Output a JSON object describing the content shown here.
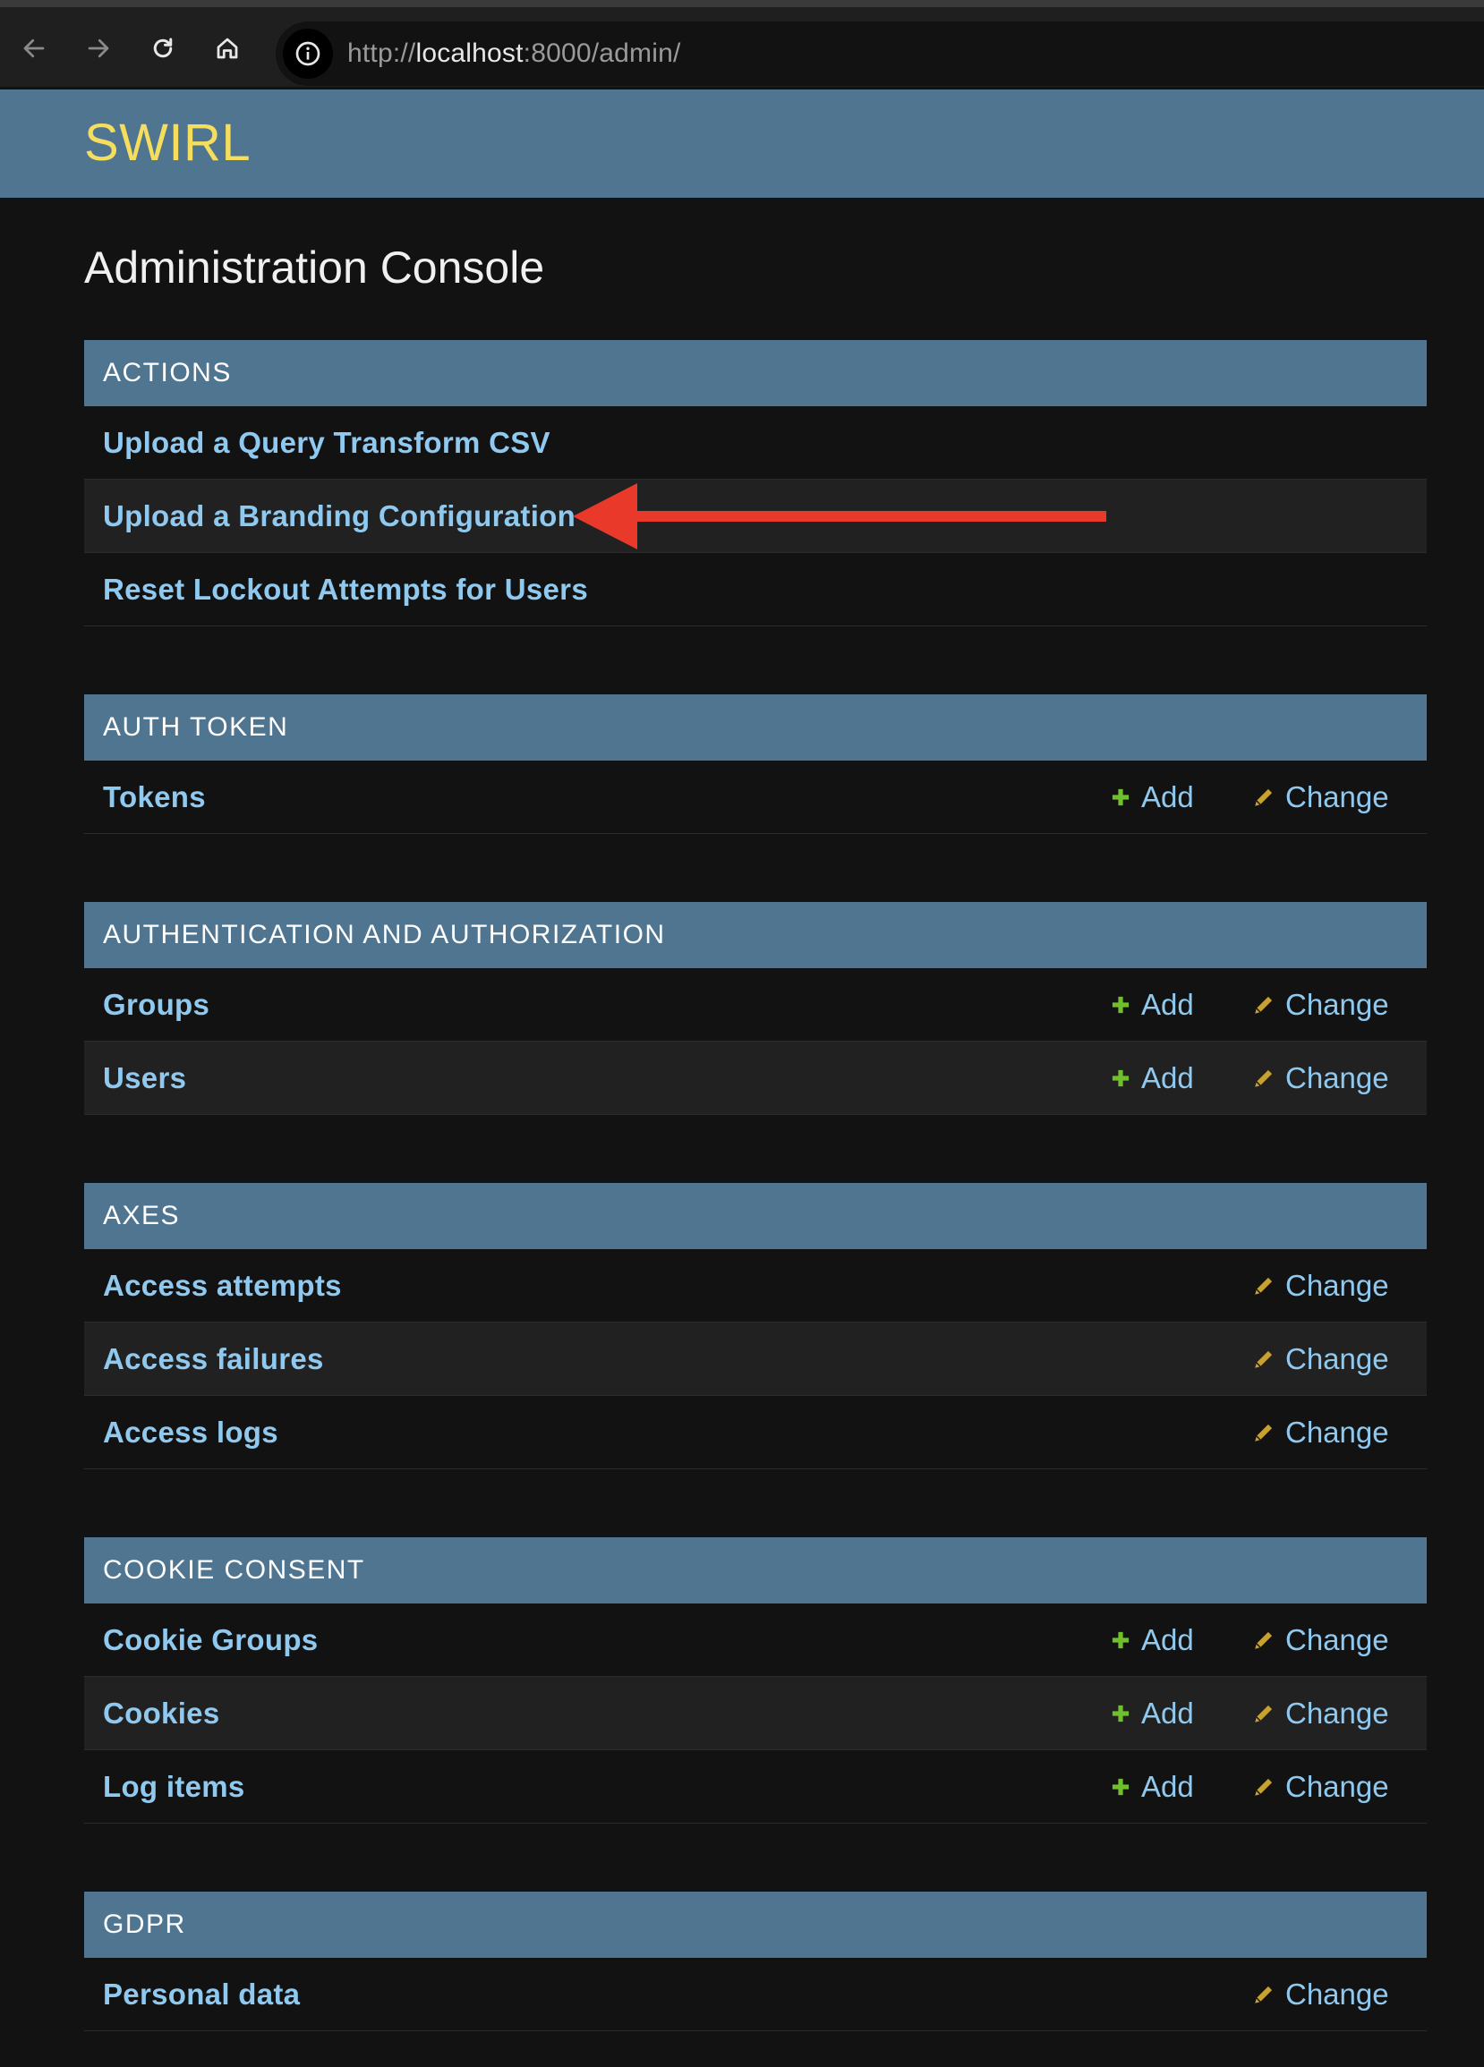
{
  "browser": {
    "url_scheme": "http://",
    "url_host": "localhost",
    "url_rest": ":8000/admin/"
  },
  "header": {
    "brand": "SWIRL"
  },
  "page": {
    "title": "Administration Console"
  },
  "actions": {
    "caption": "ACTIONS",
    "items": [
      {
        "label": "Upload a Query Transform CSV"
      },
      {
        "label": "Upload a Branding Configuration"
      },
      {
        "label": "Reset Lockout Attempts for Users"
      }
    ]
  },
  "auth_token": {
    "caption": "AUTH TOKEN",
    "rows": [
      {
        "label": "Tokens",
        "add": "Add",
        "change": "Change"
      }
    ]
  },
  "auth": {
    "caption": "AUTHENTICATION AND AUTHORIZATION",
    "rows": [
      {
        "label": "Groups",
        "add": "Add",
        "change": "Change"
      },
      {
        "label": "Users",
        "add": "Add",
        "change": "Change"
      }
    ]
  },
  "axes": {
    "caption": "AXES",
    "rows": [
      {
        "label": "Access attempts",
        "change": "Change"
      },
      {
        "label": "Access failures",
        "change": "Change"
      },
      {
        "label": "Access logs",
        "change": "Change"
      }
    ]
  },
  "cookie_consent": {
    "caption": "COOKIE CONSENT",
    "rows": [
      {
        "label": "Cookie Groups",
        "add": "Add",
        "change": "Change"
      },
      {
        "label": "Cookies",
        "add": "Add",
        "change": "Change"
      },
      {
        "label": "Log items",
        "add": "Add",
        "change": "Change"
      }
    ]
  },
  "gdpr": {
    "caption": "GDPR",
    "rows": [
      {
        "label": "Personal data",
        "change": "Change"
      }
    ]
  },
  "colors": {
    "header_bg": "#4f7590",
    "brand": "#f5dd5d",
    "link": "#8fc9ef",
    "add_icon": "#70bf2b",
    "change_icon": "#c9a130",
    "annotation_arrow": "#e8392a"
  }
}
